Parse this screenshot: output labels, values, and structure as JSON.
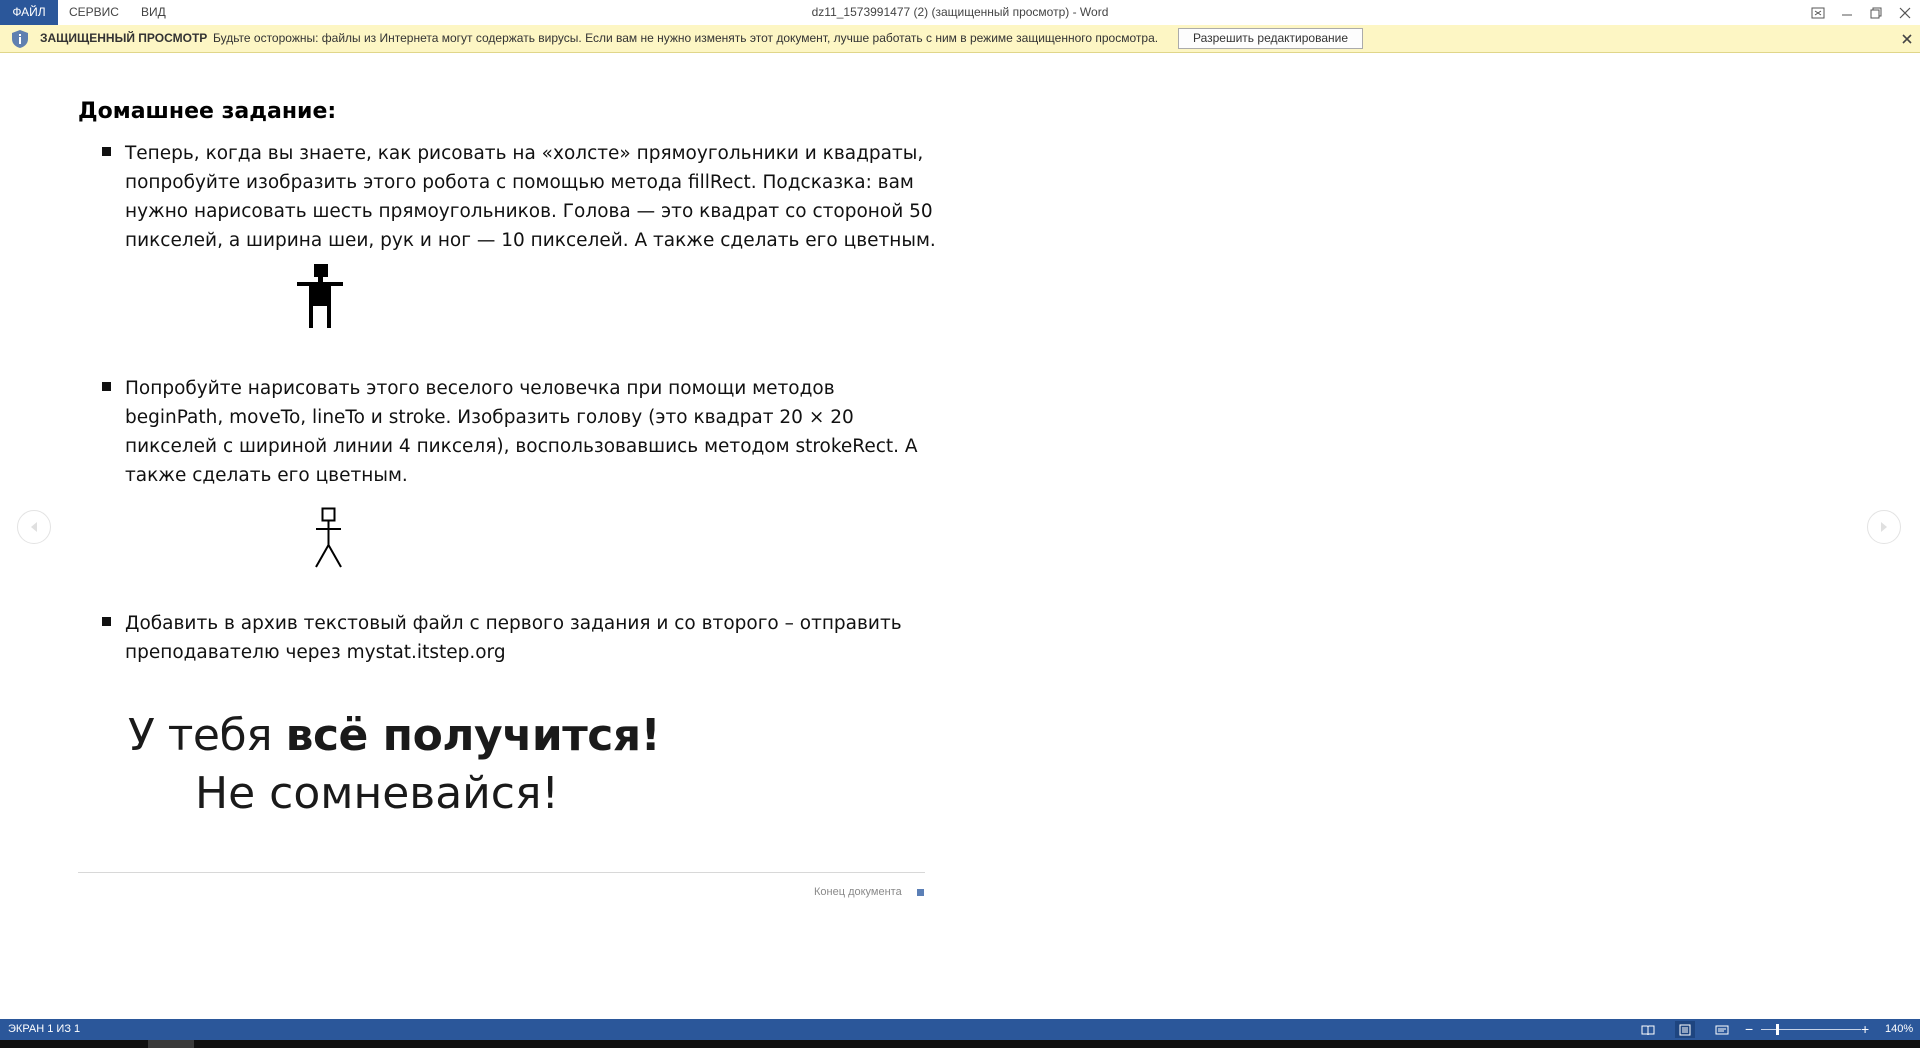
{
  "menu": {
    "file": "ФАЙЛ",
    "tools": "СЕРВИС",
    "view": "ВИД"
  },
  "window": {
    "title": "dz11_1573991477 (2) (защищенный просмотр) - Word"
  },
  "protected_view": {
    "title": "ЗАЩИЩЕННЫЙ ПРОСМОТР",
    "message": "Будьте осторожны: файлы из Интернета могут содержать вирусы. Если вам не нужно изменять этот документ, лучше работать с ним в режиме защищенного просмотра.",
    "enable_button": "Разрешить редактирование"
  },
  "document": {
    "heading": "Домашнее задание:",
    "task1": [
      "Теперь, когда вы знаете, как рисовать на «холсте» прямоугольники и квадраты,",
      "попробуйте изобразить этого робота с помощью метода fillRect. Подсказка: вам",
      "нужно нарисовать шесть прямоугольников. Голова — это квадрат со стороной 50",
      "пикселей, а ширина шеи, рук и ног — 10 пикселей. А также сделать его цветным."
    ],
    "task2": [
      "Попробуйте нарисовать этого веселого человечка при помощи методов",
      "beginPath, moveTo, lineTo и stroke. Изобразить голову (это квадрат 20 × 20",
      "пикселей с шириной линии 4 пикселя), воспользовавшись методом strokeRect. А",
      "также сделать его цветным."
    ],
    "task3": [
      "Добавить в архив текстовый файл с первого задания и со второго – отправить",
      "преподавателю через mystat.itstep.org"
    ],
    "motto_prefix": "У тебя ",
    "motto_bold": "всё получится!",
    "motto_line2": "Не сомневайся!",
    "end_label": "Конец документа"
  },
  "status": {
    "page": "ЭКРАН 1 ИЗ 1",
    "zoom": "140%"
  },
  "colors": {
    "accent": "#2b579a",
    "protected_bg": "#fdf6c4",
    "end_mark": "#5b7fb6"
  }
}
